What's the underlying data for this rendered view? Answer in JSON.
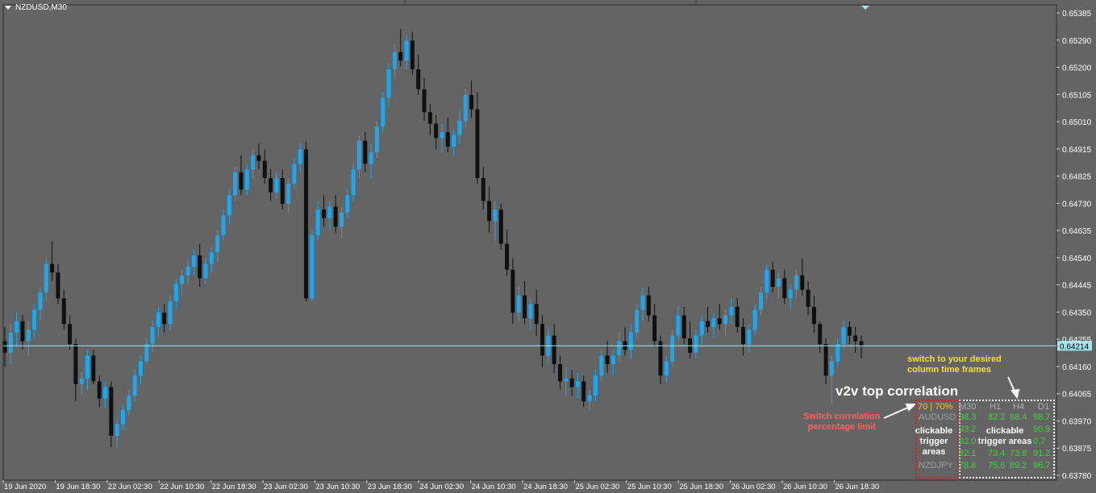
{
  "window": {
    "symbol_title": "NZDUSD,M30"
  },
  "price_axis": {
    "ticks": [
      "0.65385",
      "0.65290",
      "0.65200",
      "0.65105",
      "0.65010",
      "0.64915",
      "0.64825",
      "0.64730",
      "0.64635",
      "0.64540",
      "0.64445",
      "0.64350",
      "0.64255",
      "0.64160",
      "0.64065",
      "0.63970",
      "0.63875",
      "0.63780"
    ],
    "current_price": "0.64214"
  },
  "time_axis": {
    "ticks": [
      "19 Jun 2020",
      "19 Jun 18:30",
      "22 Jun 02:30",
      "22 Jun 10:30",
      "22 Jun 18:30",
      "23 Jun 02:30",
      "23 Jun 10:30",
      "23 Jun 18:30",
      "24 Jun 02:30",
      "24 Jun 10:30",
      "24 Jun 18:30",
      "25 Jun 02:30",
      "25 Jun 10:30",
      "25 Jun 18:30",
      "26 Jun 02:30",
      "26 Jun 10:30",
      "26 Jun 18:30"
    ]
  },
  "colors": {
    "bull": "#1ea7ef",
    "bear": "#101010",
    "background": "#646464",
    "price_line": "#9ee6f0",
    "grid": "#555555"
  },
  "chart_data": {
    "type": "candlestick",
    "symbol": "NZDUSD",
    "timeframe": "M30",
    "ylim": [
      0.63745,
      0.65405
    ],
    "candles": [
      [
        0.6423,
        0.6428,
        0.6414,
        0.6419
      ],
      [
        0.6419,
        0.6429,
        0.6415,
        0.6426
      ],
      [
        0.6426,
        0.6433,
        0.6421,
        0.643
      ],
      [
        0.643,
        0.6432,
        0.642,
        0.6423
      ],
      [
        0.6423,
        0.643,
        0.6418,
        0.6427
      ],
      [
        0.6427,
        0.6436,
        0.6424,
        0.6434
      ],
      [
        0.6434,
        0.6442,
        0.643,
        0.644
      ],
      [
        0.644,
        0.6452,
        0.6437,
        0.645
      ],
      [
        0.645,
        0.6458,
        0.6444,
        0.6447
      ],
      [
        0.6447,
        0.645,
        0.6436,
        0.6438
      ],
      [
        0.6438,
        0.6441,
        0.6427,
        0.6429
      ],
      [
        0.6429,
        0.6432,
        0.642,
        0.6422
      ],
      [
        0.6422,
        0.6424,
        0.6402,
        0.6408
      ],
      [
        0.6408,
        0.6412,
        0.6404,
        0.641
      ],
      [
        0.641,
        0.642,
        0.6406,
        0.6418
      ],
      [
        0.6418,
        0.642,
        0.6408,
        0.6409
      ],
      [
        0.6409,
        0.6411,
        0.64,
        0.6403
      ],
      [
        0.6403,
        0.6409,
        0.64,
        0.6407
      ],
      [
        0.6407,
        0.6409,
        0.6386,
        0.639
      ],
      [
        0.639,
        0.6396,
        0.6386,
        0.6394
      ],
      [
        0.6394,
        0.6401,
        0.6392,
        0.6399
      ],
      [
        0.6399,
        0.6406,
        0.6397,
        0.6404
      ],
      [
        0.6404,
        0.6413,
        0.6402,
        0.6411
      ],
      [
        0.6411,
        0.6418,
        0.6408,
        0.6416
      ],
      [
        0.6416,
        0.6424,
        0.6415,
        0.6422
      ],
      [
        0.6422,
        0.643,
        0.6419,
        0.6428
      ],
      [
        0.6428,
        0.6435,
        0.6425,
        0.6433
      ],
      [
        0.6433,
        0.6436,
        0.6426,
        0.6429
      ],
      [
        0.6429,
        0.6439,
        0.6427,
        0.6437
      ],
      [
        0.6437,
        0.6445,
        0.6434,
        0.6443
      ],
      [
        0.6443,
        0.6448,
        0.6439,
        0.6446
      ],
      [
        0.6446,
        0.6451,
        0.6443,
        0.6449
      ],
      [
        0.6449,
        0.6455,
        0.6446,
        0.6453
      ],
      [
        0.6453,
        0.6457,
        0.6442,
        0.6445
      ],
      [
        0.6445,
        0.6452,
        0.6443,
        0.645
      ],
      [
        0.645,
        0.6456,
        0.6447,
        0.6454
      ],
      [
        0.6454,
        0.6462,
        0.6451,
        0.646
      ],
      [
        0.646,
        0.6469,
        0.6458,
        0.6467
      ],
      [
        0.6467,
        0.6476,
        0.6464,
        0.6474
      ],
      [
        0.6474,
        0.6484,
        0.6472,
        0.6482
      ],
      [
        0.6482,
        0.6488,
        0.6474,
        0.6476
      ],
      [
        0.6476,
        0.6485,
        0.6474,
        0.6483
      ],
      [
        0.6483,
        0.649,
        0.648,
        0.6488
      ],
      [
        0.6488,
        0.6492,
        0.6483,
        0.6486
      ],
      [
        0.6486,
        0.649,
        0.6478,
        0.648
      ],
      [
        0.648,
        0.6483,
        0.6472,
        0.6475
      ],
      [
        0.6475,
        0.6482,
        0.6473,
        0.648
      ],
      [
        0.648,
        0.6483,
        0.6469,
        0.6471
      ],
      [
        0.6471,
        0.648,
        0.6468,
        0.6478
      ],
      [
        0.6478,
        0.6487,
        0.6476,
        0.6485
      ],
      [
        0.6485,
        0.6492,
        0.6482,
        0.649
      ],
      [
        0.649,
        0.6493,
        0.6437,
        0.6438
      ],
      [
        0.6438,
        0.6462,
        0.6437,
        0.646
      ],
      [
        0.646,
        0.6472,
        0.6458,
        0.6469
      ],
      [
        0.6469,
        0.6474,
        0.6463,
        0.6466
      ],
      [
        0.6466,
        0.6472,
        0.6462,
        0.647
      ],
      [
        0.647,
        0.6474,
        0.6461,
        0.6463
      ],
      [
        0.6463,
        0.647,
        0.6459,
        0.6468
      ],
      [
        0.6468,
        0.6476,
        0.6466,
        0.6474
      ],
      [
        0.6474,
        0.6485,
        0.6472,
        0.6483
      ],
      [
        0.6483,
        0.6495,
        0.648,
        0.6493
      ],
      [
        0.6493,
        0.6496,
        0.6482,
        0.6485
      ],
      [
        0.6485,
        0.6492,
        0.648,
        0.6489
      ],
      [
        0.6489,
        0.65,
        0.6487,
        0.6498
      ],
      [
        0.6498,
        0.651,
        0.6496,
        0.6508
      ],
      [
        0.6508,
        0.652,
        0.6505,
        0.6518
      ],
      [
        0.6518,
        0.6527,
        0.6515,
        0.6524
      ],
      [
        0.6524,
        0.6532,
        0.6519,
        0.6521
      ],
      [
        0.6521,
        0.653,
        0.6518,
        0.6528
      ],
      [
        0.6528,
        0.6531,
        0.6516,
        0.6518
      ],
      [
        0.6518,
        0.6523,
        0.6509,
        0.6511
      ],
      [
        0.6511,
        0.6515,
        0.65,
        0.6503
      ],
      [
        0.6503,
        0.6506,
        0.6495,
        0.6499
      ],
      [
        0.6499,
        0.6502,
        0.649,
        0.6494
      ],
      [
        0.6494,
        0.6499,
        0.6489,
        0.6496
      ],
      [
        0.6496,
        0.6501,
        0.6489,
        0.6491
      ],
      [
        0.6491,
        0.6497,
        0.6488,
        0.6495
      ],
      [
        0.6495,
        0.6504,
        0.6492,
        0.65
      ],
      [
        0.65,
        0.6511,
        0.6498,
        0.6509
      ],
      [
        0.6509,
        0.6514,
        0.6501,
        0.6504
      ],
      [
        0.6504,
        0.651,
        0.6478,
        0.648
      ],
      [
        0.648,
        0.6484,
        0.6469,
        0.6472
      ],
      [
        0.6472,
        0.6477,
        0.6461,
        0.6465
      ],
      [
        0.6465,
        0.6472,
        0.6458,
        0.6469
      ],
      [
        0.6469,
        0.6471,
        0.6455,
        0.6457
      ],
      [
        0.6457,
        0.6462,
        0.6446,
        0.6448
      ],
      [
        0.6448,
        0.6452,
        0.6429,
        0.6433
      ],
      [
        0.6433,
        0.6442,
        0.643,
        0.6439
      ],
      [
        0.6439,
        0.6444,
        0.6429,
        0.6431
      ],
      [
        0.6431,
        0.6438,
        0.6427,
        0.6436
      ],
      [
        0.6436,
        0.6441,
        0.6425,
        0.6429
      ],
      [
        0.6429,
        0.6432,
        0.6414,
        0.6418
      ],
      [
        0.6418,
        0.6428,
        0.6415,
        0.6425
      ],
      [
        0.6425,
        0.6429,
        0.6412,
        0.6415
      ],
      [
        0.6415,
        0.6418,
        0.6406,
        0.6409
      ],
      [
        0.6409,
        0.6414,
        0.6404,
        0.641
      ],
      [
        0.641,
        0.6413,
        0.6404,
        0.6407
      ],
      [
        0.6407,
        0.6412,
        0.6403,
        0.6409
      ],
      [
        0.6409,
        0.6411,
        0.64,
        0.6402
      ],
      [
        0.6402,
        0.6406,
        0.6399,
        0.6404
      ],
      [
        0.6404,
        0.6413,
        0.6402,
        0.6411
      ],
      [
        0.6411,
        0.642,
        0.6409,
        0.6418
      ],
      [
        0.6418,
        0.6423,
        0.6412,
        0.6415
      ],
      [
        0.6415,
        0.642,
        0.6411,
        0.6418
      ],
      [
        0.6418,
        0.6426,
        0.6416,
        0.6423
      ],
      [
        0.6423,
        0.6428,
        0.6418,
        0.642
      ],
      [
        0.642,
        0.6429,
        0.6417,
        0.6426
      ],
      [
        0.6426,
        0.6436,
        0.6424,
        0.6434
      ],
      [
        0.6434,
        0.6442,
        0.643,
        0.6439
      ],
      [
        0.6439,
        0.6442,
        0.643,
        0.6432
      ],
      [
        0.6432,
        0.6436,
        0.6421,
        0.6423
      ],
      [
        0.6423,
        0.6425,
        0.6408,
        0.6411
      ],
      [
        0.6411,
        0.6418,
        0.6409,
        0.6416
      ],
      [
        0.6416,
        0.6427,
        0.6414,
        0.6425
      ],
      [
        0.6425,
        0.6435,
        0.6423,
        0.6432
      ],
      [
        0.6432,
        0.6435,
        0.6422,
        0.6424
      ],
      [
        0.6424,
        0.643,
        0.6417,
        0.6419
      ],
      [
        0.6419,
        0.6427,
        0.6417,
        0.6425
      ],
      [
        0.6425,
        0.6432,
        0.6422,
        0.643
      ],
      [
        0.643,
        0.6435,
        0.6426,
        0.6428
      ],
      [
        0.6428,
        0.6433,
        0.6424,
        0.6431
      ],
      [
        0.6431,
        0.6436,
        0.6427,
        0.6429
      ],
      [
        0.6429,
        0.6434,
        0.6425,
        0.6432
      ],
      [
        0.6432,
        0.6438,
        0.6429,
        0.6435
      ],
      [
        0.6435,
        0.6438,
        0.6426,
        0.6428
      ],
      [
        0.6428,
        0.6431,
        0.6418,
        0.6422
      ],
      [
        0.6422,
        0.6429,
        0.6419,
        0.6427
      ],
      [
        0.6427,
        0.6436,
        0.6425,
        0.6434
      ],
      [
        0.6434,
        0.6442,
        0.6432,
        0.644
      ],
      [
        0.644,
        0.645,
        0.6438,
        0.6448
      ],
      [
        0.6448,
        0.6451,
        0.644,
        0.6442
      ],
      [
        0.6442,
        0.6447,
        0.6438,
        0.6445
      ],
      [
        0.6445,
        0.6448,
        0.6436,
        0.6438
      ],
      [
        0.6438,
        0.6443,
        0.6434,
        0.6441
      ],
      [
        0.6441,
        0.6448,
        0.6438,
        0.6446
      ],
      [
        0.6446,
        0.6452,
        0.6439,
        0.6441
      ],
      [
        0.6441,
        0.6444,
        0.6432,
        0.6435
      ],
      [
        0.6435,
        0.6439,
        0.6426,
        0.6429
      ],
      [
        0.6429,
        0.643,
        0.6419,
        0.6422
      ],
      [
        0.6422,
        0.6424,
        0.6408,
        0.6411
      ],
      [
        0.6411,
        0.6418,
        0.6401,
        0.6416
      ],
      [
        0.6416,
        0.6424,
        0.6414,
        0.6422
      ],
      [
        0.6422,
        0.643,
        0.642,
        0.6428
      ],
      [
        0.6428,
        0.643,
        0.6422,
        0.6425
      ],
      [
        0.6425,
        0.6428,
        0.6419,
        0.6423
      ],
      [
        0.6423,
        0.6425,
        0.6417,
        0.64214
      ]
    ],
    "current_price": 0.64214,
    "grid": false
  },
  "indicator": {
    "title": "v2v top correlation",
    "annotations": {
      "switch_timeframes": [
        "switch to your desired",
        "column time frames"
      ],
      "switch_pct": [
        "Switch correlation",
        "percentage limit"
      ],
      "trigger_left": [
        "clickable",
        "trigger",
        "areas"
      ],
      "trigger_right": [
        "clickable",
        "trigger areas"
      ]
    },
    "pct_label": "70 | 70%",
    "columns": [
      "M30",
      "H1",
      "H4",
      "D1"
    ],
    "rows": [
      {
        "symbol": "AUDUSD",
        "values": [
          "98.3",
          "82.2",
          "88.4",
          "98.7"
        ]
      },
      {
        "symbol": "",
        "values": [
          "93.2",
          "",
          "",
          "90.9"
        ]
      },
      {
        "symbol": "",
        "values": [
          "92.0",
          "",
          "",
          "0.7"
        ]
      },
      {
        "symbol": "",
        "values": [
          "82.1",
          "73.4",
          "73.8",
          "91.2"
        ]
      },
      {
        "symbol": "NZDJPY",
        "values": [
          "78.8",
          "75.6",
          "89.2",
          "96.7"
        ]
      }
    ]
  }
}
